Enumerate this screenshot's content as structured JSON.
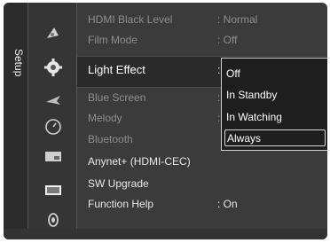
{
  "side_tab": {
    "label": "Setup"
  },
  "icons": [
    "satellite-dish-icon",
    "gear-settings-icon",
    "bird-input-icon",
    "clock-icon",
    "screen-picture-icon",
    "monitor-icon",
    "speaker-sound-icon"
  ],
  "menu": {
    "items": [
      {
        "label": "HDMI Black Level",
        "value": ": Normal"
      },
      {
        "label": "Film Mode",
        "value": ": Off"
      },
      {
        "label": "Light Effect",
        "value": ":"
      },
      {
        "label": "Blue Screen",
        "value": ":"
      },
      {
        "label": "Melody",
        "value": ":"
      },
      {
        "label": "Bluetooth",
        "value": ""
      },
      {
        "label": "Anynet+ (HDMI-CEC)",
        "value": ""
      },
      {
        "label": "SW Upgrade",
        "value": ""
      },
      {
        "label": "Function Help",
        "value": ": On"
      }
    ],
    "selected_index": 2
  },
  "popup": {
    "options": [
      "Off",
      "In Standby",
      "In Watching",
      "Always"
    ],
    "highlighted_index": 3
  }
}
